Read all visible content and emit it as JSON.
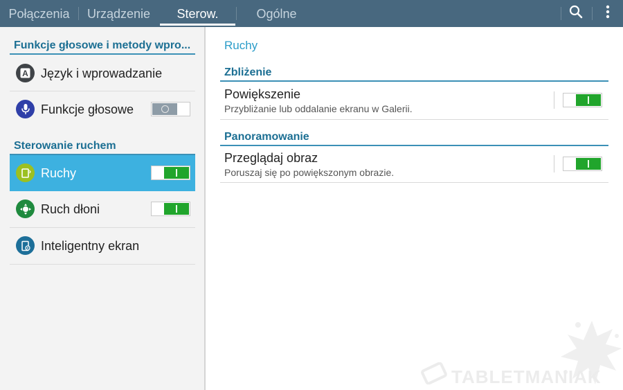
{
  "tabs": [
    {
      "label": "Połączenia"
    },
    {
      "label": "Urządzenie"
    },
    {
      "label": "Sterow."
    },
    {
      "label": "Ogólne"
    }
  ],
  "icons": {
    "search": "search-icon",
    "more": "more-vertical-icon"
  },
  "left": {
    "section1": "Funkcje głosowe i metody wpro...",
    "section2": "Sterowanie ruchem",
    "items": [
      {
        "label": "Język i wprowadzanie",
        "icon": "keyboard-a-icon"
      },
      {
        "label": "Funkcje głosowe",
        "icon": "microphone-icon",
        "toggle": "off"
      },
      {
        "label": "Ruchy",
        "icon": "motion-icon",
        "toggle": "on"
      },
      {
        "label": "Ruch dłoni",
        "icon": "palm-motion-icon",
        "toggle": "on"
      },
      {
        "label": "Inteligentny ekran",
        "icon": "smart-screen-icon"
      }
    ]
  },
  "right": {
    "heading": "Ruchy",
    "sections": [
      {
        "title": "Zbliżenie",
        "item_title": "Powiększenie",
        "item_sub": "Przybliżanie lub oddalanie ekranu w Galerii.",
        "toggle": "on"
      },
      {
        "title": "Panoramowanie",
        "item_title": "Przeglądaj obraz",
        "item_sub": "Poruszaj się po powiększonym obrazie.",
        "toggle": "on"
      }
    ]
  },
  "watermark": "TABLETMANIAK",
  "colors": {
    "topbar": "#48687f",
    "accent": "#3db1e0",
    "section": "#1c6f93",
    "switch_on": "#21a52c"
  }
}
